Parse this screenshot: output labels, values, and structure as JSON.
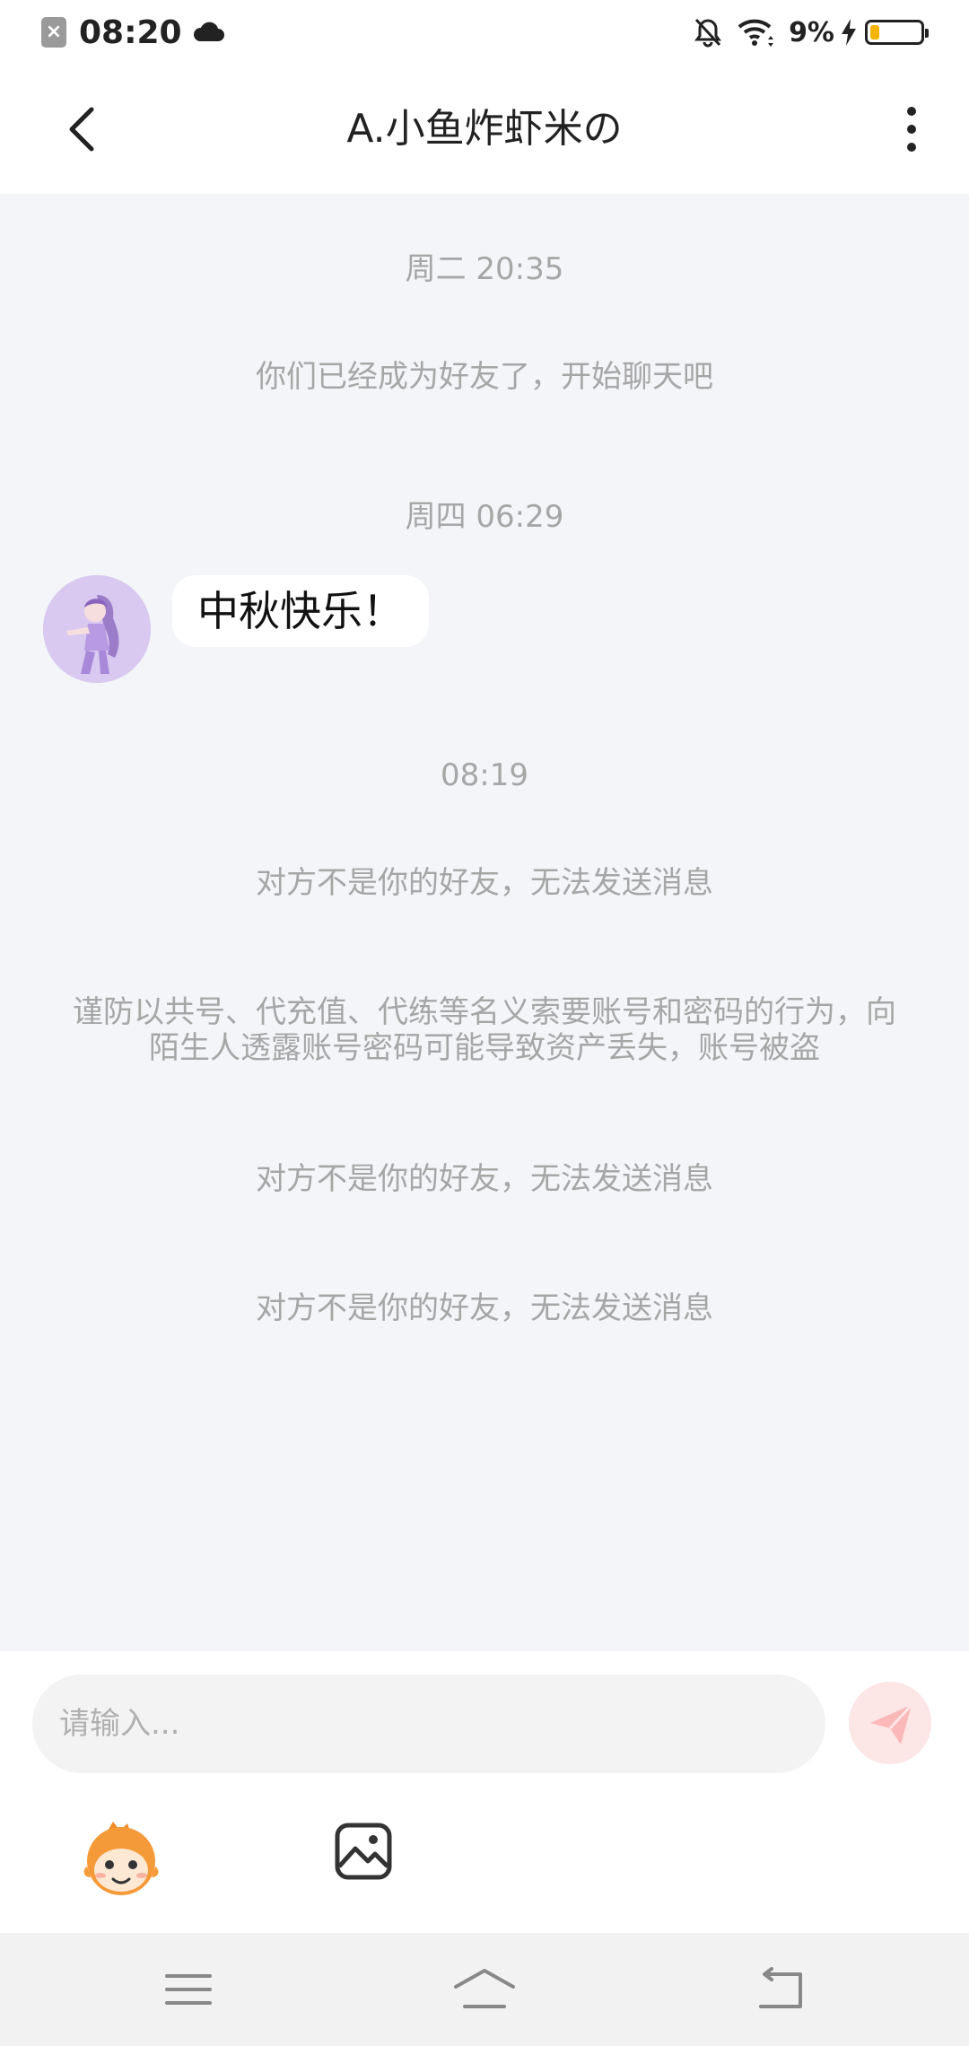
{
  "status_bar": {
    "time": "08:20",
    "battery_percent": "9%",
    "battery_level": 0.09,
    "icons": [
      "notification-x-icon",
      "cloud-icon",
      "bell-off-icon",
      "wifi-icon",
      "charging-icon",
      "battery-icon"
    ]
  },
  "header": {
    "title": "A.小鱼炸虾米の",
    "back_icon": "chevron-left-icon",
    "more_icon": "more-vertical-icon"
  },
  "chat": {
    "items": [
      {
        "type": "timestamp",
        "text": "周二 20:35"
      },
      {
        "type": "system",
        "text": "你们已经成为好友了，开始聊天吧"
      },
      {
        "type": "timestamp",
        "text": "周四 06:29"
      },
      {
        "type": "message",
        "text": "中秋快乐！",
        "sender": "other"
      },
      {
        "type": "timestamp",
        "text": "08:19"
      },
      {
        "type": "system",
        "text": "对方不是你的好友，无法发送消息"
      },
      {
        "type": "system",
        "text": "谨防以共号、代充值、代练等名义索要账号和密码的行为，向陌生人透露账号密码可能导致资产丢失，账号被盗"
      },
      {
        "type": "system",
        "text": "对方不是你的好友，无法发送消息"
      },
      {
        "type": "system",
        "text": "对方不是你的好友，无法发送消息"
      }
    ]
  },
  "input": {
    "placeholder": "请输入...",
    "value": ""
  },
  "toolbar": {
    "emoji_icon": "emoji-sticker-icon",
    "image_icon": "image-icon",
    "send_icon": "send-icon"
  },
  "nav": {
    "icons": [
      "menu-icon",
      "home-icon",
      "back-icon"
    ]
  },
  "colors": {
    "chat_background": "#f3f5f8",
    "system_text": "#a6a6a6",
    "send_button": "#fde6e6",
    "battery_fill": "#f4b400"
  }
}
